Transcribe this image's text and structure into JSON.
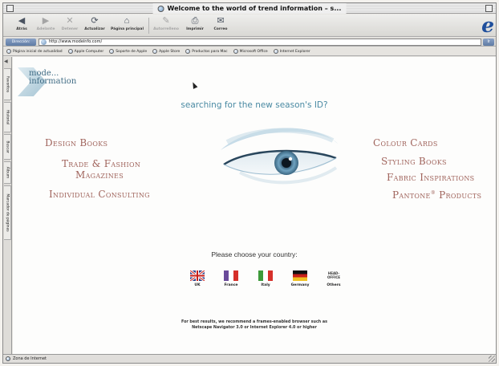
{
  "window": {
    "title": "Welcome to the world of trend information – s..."
  },
  "toolbar": {
    "buttons": [
      {
        "label": "Atrás",
        "icon": "back-arrow-icon"
      },
      {
        "label": "Adelante",
        "icon": "forward-arrow-icon"
      },
      {
        "label": "Detener",
        "icon": "stop-icon"
      },
      {
        "label": "Actualizar",
        "icon": "refresh-icon"
      },
      {
        "label": "Página principal",
        "icon": "home-icon"
      },
      {
        "label": "Autorrelleno",
        "icon": "autofill-icon"
      },
      {
        "label": "Imprimir",
        "icon": "print-icon"
      },
      {
        "label": "Correo",
        "icon": "mail-icon"
      }
    ]
  },
  "address": {
    "label": "Dirección:",
    "url": "http://www.modeinfo.com/",
    "go": "Ir"
  },
  "favorites": [
    "Página inicial de actualidad",
    "Apple Computer",
    "Soporte de Apple",
    "Apple Store",
    "Productos para Mac",
    "Microsoft Office",
    "Internet Explorer"
  ],
  "sidebar_tabs": [
    "Favoritos",
    "Historial",
    "Buscar",
    "Álbum",
    "Marcador de páginas"
  ],
  "page": {
    "logo_line1": "mode...",
    "logo_line2": "information",
    "tagline": "searching for the new season's ID?",
    "left_menu": [
      "Design Books",
      "Trade & Fashion",
      "Magazines",
      "Individual Consulting"
    ],
    "right_menu": [
      "Colour Cards",
      "Styling Books",
      "Fabric Inspirations",
      "Pantone",
      "Products"
    ],
    "pantone_mark": "®",
    "choose_country": "Please choose your country:",
    "countries": [
      {
        "label": "UK"
      },
      {
        "label": "France"
      },
      {
        "label": "Italy"
      },
      {
        "label": "Germany"
      },
      {
        "label": "Others",
        "badge": "HEAD-OFFICE"
      }
    ],
    "note_line1": "For best results, we recommend a frames-enabled browser such as",
    "note_line2": "Netscape Navigator 3.0 or Internet Explorer 4.0 or higher"
  },
  "status": {
    "text": "Zona de Internet"
  },
  "colors": {
    "menu_text": "#a0645c",
    "tagline": "#4a8aa3",
    "logo": "#3f6b84"
  }
}
